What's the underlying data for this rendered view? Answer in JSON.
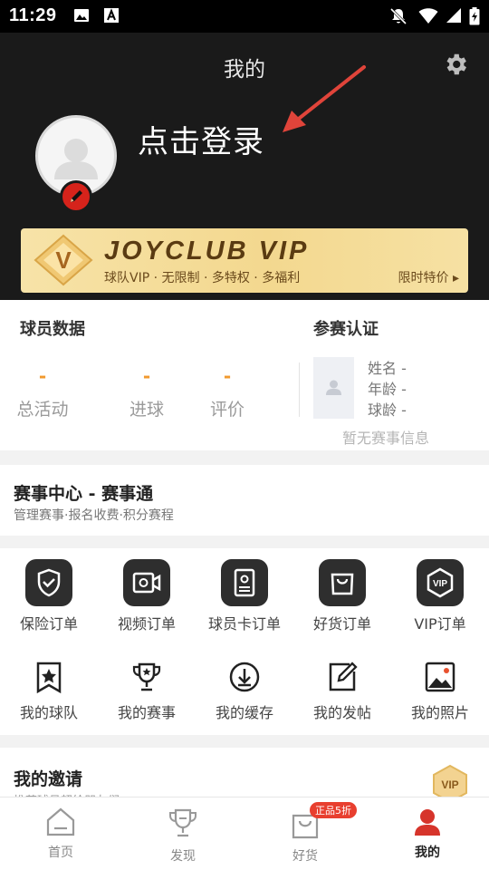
{
  "status_bar": {
    "time": "11:29"
  },
  "header": {
    "title": "我的",
    "login_prompt": "点击登录"
  },
  "vip_banner": {
    "title": "JOYCLUB VIP",
    "subtitle": "球队VIP · 无限制 · 多特权 · 多福利",
    "promo": "限时特价",
    "logo_letter": "V"
  },
  "player_data": {
    "title": "球员数据",
    "stats": [
      {
        "value": "-",
        "label": "总活动"
      },
      {
        "value": "-",
        "label": "进球"
      },
      {
        "value": "-",
        "label": "评价"
      }
    ]
  },
  "certification": {
    "title": "参赛认证",
    "fields": [
      {
        "label": "姓名",
        "value": "-"
      },
      {
        "label": "年龄",
        "value": "-"
      },
      {
        "label": "球龄",
        "value": "-"
      }
    ],
    "empty_text": "暂无赛事信息"
  },
  "match_center": {
    "title": "赛事中心 - 赛事通",
    "subtitle": "管理赛事·报名收费·积分赛程"
  },
  "orders": [
    {
      "label": "保险订单",
      "icon": "shield-check-icon"
    },
    {
      "label": "视频订单",
      "icon": "video-camera-icon"
    },
    {
      "label": "球员卡订单",
      "icon": "id-card-icon"
    },
    {
      "label": "好货订单",
      "icon": "shopping-bag-icon"
    },
    {
      "label": "VIP订单",
      "icon": "vip-hexagon-icon"
    }
  ],
  "mine": [
    {
      "label": "我的球队",
      "icon": "star-badge-icon"
    },
    {
      "label": "我的赛事",
      "icon": "trophy-icon"
    },
    {
      "label": "我的缓存",
      "icon": "download-icon"
    },
    {
      "label": "我的发帖",
      "icon": "edit-post-icon"
    },
    {
      "label": "我的照片",
      "icon": "photo-icon"
    }
  ],
  "invite": {
    "title": "我的邀请",
    "subtitle": "推荐球员超给朋友们",
    "badge": "VIP"
  },
  "tabbar": {
    "tabs": [
      {
        "label": "首页",
        "icon": "home-icon"
      },
      {
        "label": "发现",
        "icon": "trophy-icon"
      },
      {
        "label": "好货",
        "icon": "shopping-bag-icon"
      },
      {
        "label": "我的",
        "icon": "user-icon"
      }
    ],
    "active_index": 3,
    "promo_badge": "正品5折"
  },
  "colors": {
    "header_bg": "#1a1a1a",
    "accent_red": "#d6231b",
    "stat_orange": "#f29a2e",
    "vip_gold": "#f3d88f"
  }
}
